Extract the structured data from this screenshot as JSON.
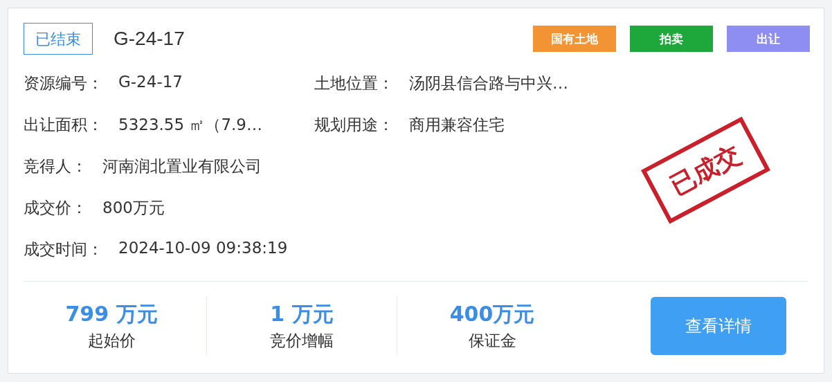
{
  "status": {
    "label": "已结束"
  },
  "title": "G-24-17",
  "tags": [
    {
      "label": "国有土地",
      "color": "#f39434"
    },
    {
      "label": "拍卖",
      "color": "#1ea83c"
    },
    {
      "label": "出让",
      "color": "#8e8ef2"
    }
  ],
  "rows": [
    [
      {
        "label": "资源编号：",
        "value": "G-24-17"
      },
      {
        "label": "土地位置：",
        "value": "汤阴县信合路与中兴…"
      }
    ],
    [
      {
        "label": "出让面积：",
        "value": "5323.55 ㎡（7.9…"
      },
      {
        "label": "规划用途：",
        "value": "商用兼容住宅"
      }
    ],
    [
      {
        "label": "竞得人：",
        "value": "河南润北置业有限公司"
      }
    ],
    [
      {
        "label": "成交价：",
        "value": "800万元"
      }
    ],
    [
      {
        "label": "成交时间：",
        "value": "2024-10-09 09:38:19"
      }
    ]
  ],
  "stamp": {
    "text": "已成交"
  },
  "stats": [
    {
      "value": "799 万元",
      "label": "起始价"
    },
    {
      "value": "1 万元",
      "label": "竞价增幅"
    },
    {
      "value": "400万元",
      "label": "保证金"
    }
  ],
  "button": {
    "label": "查看详情"
  }
}
